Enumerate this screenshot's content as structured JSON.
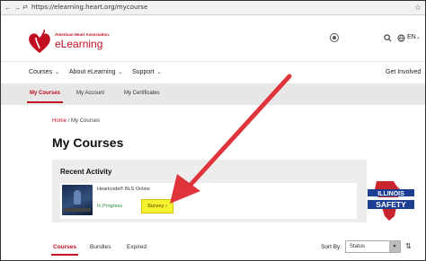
{
  "browser": {
    "url": "https://elearning.heart.org/mycourse",
    "nav_glyph": "←  →",
    "lock_glyph": "⇄",
    "star_glyph": "☆"
  },
  "logo": {
    "org": "American Heart Association.",
    "brand": "eLearning"
  },
  "header": {
    "language": "EN",
    "search_icon": "search-icon",
    "globe_icon": "globe-icon",
    "user_icon": "user-icon"
  },
  "main_nav": {
    "items": [
      {
        "label": "Courses"
      },
      {
        "label": "About eLearning"
      },
      {
        "label": "Support"
      }
    ],
    "right_item": {
      "label": "Get Involved"
    },
    "chevron": "⌄"
  },
  "sub_nav": {
    "items": [
      {
        "label": "My Courses",
        "active": true
      },
      {
        "label": "My Account",
        "active": false
      },
      {
        "label": "My Certificates",
        "active": false
      }
    ]
  },
  "breadcrumb": {
    "home": "Home",
    "separator": " / ",
    "current": "My Courses"
  },
  "page_title": "My Courses",
  "recent_activity": {
    "title": "Recent Activity",
    "course": {
      "name": "Heartcode® BLS Online",
      "status": "In Progress",
      "action_label": "Survey ›"
    }
  },
  "stamp": {
    "line1": "ILLINOIS",
    "line2": "SAFETY"
  },
  "tabs": {
    "items": [
      {
        "label": "Courses",
        "active": true
      },
      {
        "label": "Bundles",
        "active": false
      },
      {
        "label": "Expired",
        "active": false
      }
    ]
  },
  "sort": {
    "label": "Sort By:",
    "selected": "Status",
    "caret": "▾",
    "swap_glyph": "⇅"
  },
  "colors": {
    "brand_red": "#c10e21",
    "highlight": "#f3f330",
    "arrow": "#e0343c",
    "in_progress": "#2e8b3a"
  }
}
